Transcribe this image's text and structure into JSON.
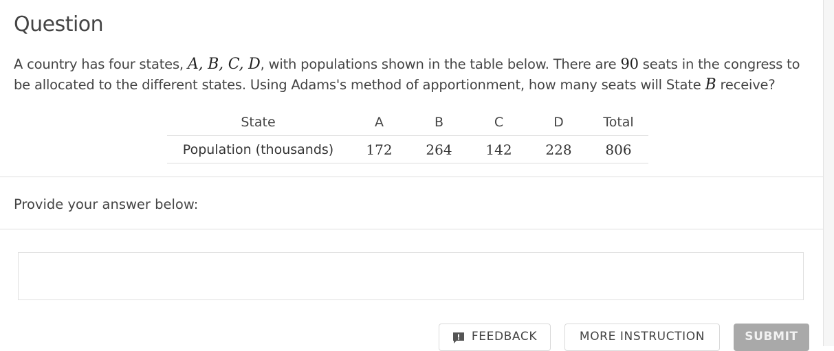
{
  "question": {
    "title": "Question",
    "text_parts": {
      "p1": "A country has four states, ",
      "states_math": "A, B, C, D",
      "p2": ", with populations shown in the table below. There are ",
      "seats": "90",
      "p3": " seats in the congress to be allocated to the different states. Using Adams's method of apportionment, how many seats will State ",
      "target_state": "B",
      "p4": " receive?"
    }
  },
  "table": {
    "header_label": "State",
    "columns": [
      "A",
      "B",
      "C",
      "D",
      "Total"
    ],
    "row_label": "Population (thousands)",
    "values": [
      "172",
      "264",
      "142",
      "228",
      "806"
    ]
  },
  "answer": {
    "prompt": "Provide your answer below:",
    "value": "",
    "placeholder": ""
  },
  "buttons": {
    "feedback": "FEEDBACK",
    "more_instruction": "MORE INSTRUCTION",
    "submit": "SUBMIT"
  },
  "colors": {
    "submit_disabled_bg": "#a9a9a9",
    "text": "#444444"
  }
}
